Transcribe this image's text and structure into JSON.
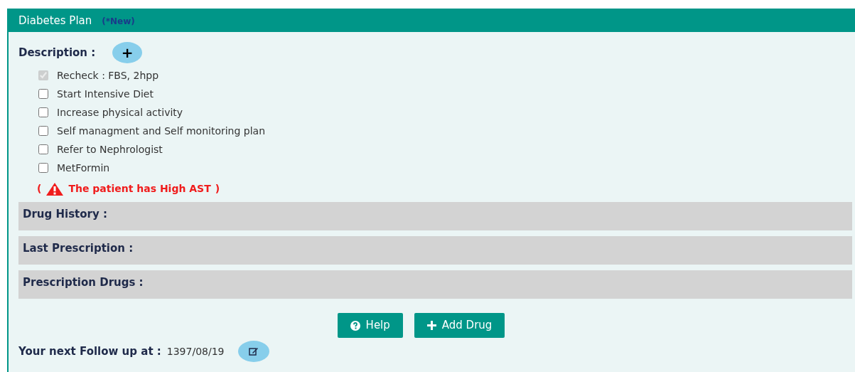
{
  "panel": {
    "title": "Diabetes Plan",
    "badge": "(*New)"
  },
  "description": {
    "label": "Description :",
    "add_button": "+"
  },
  "items": [
    {
      "label": "Recheck : FBS, 2hpp",
      "checked": true,
      "disabled": true
    },
    {
      "label": "Start Intensive Diet",
      "checked": false,
      "disabled": false
    },
    {
      "label": "Increase physical activity",
      "checked": false,
      "disabled": false
    },
    {
      "label": "Self managment and Self monitoring plan",
      "checked": false,
      "disabled": false
    },
    {
      "label": "Refer to Nephrologist",
      "checked": false,
      "disabled": false
    },
    {
      "label": "MetFormin",
      "checked": false,
      "disabled": false
    }
  ],
  "warning": {
    "open": "(",
    "text": "The patient has High AST",
    "close": ")"
  },
  "sections": [
    "Drug History :",
    "Last Prescription :",
    "Prescription Drugs :"
  ],
  "buttons": [
    {
      "label": "Help",
      "kind": "help"
    },
    {
      "label": "Add Drug",
      "kind": "add"
    }
  ],
  "follow_up": {
    "label": "Your next Follow up at :",
    "date": "1397/08/19"
  }
}
